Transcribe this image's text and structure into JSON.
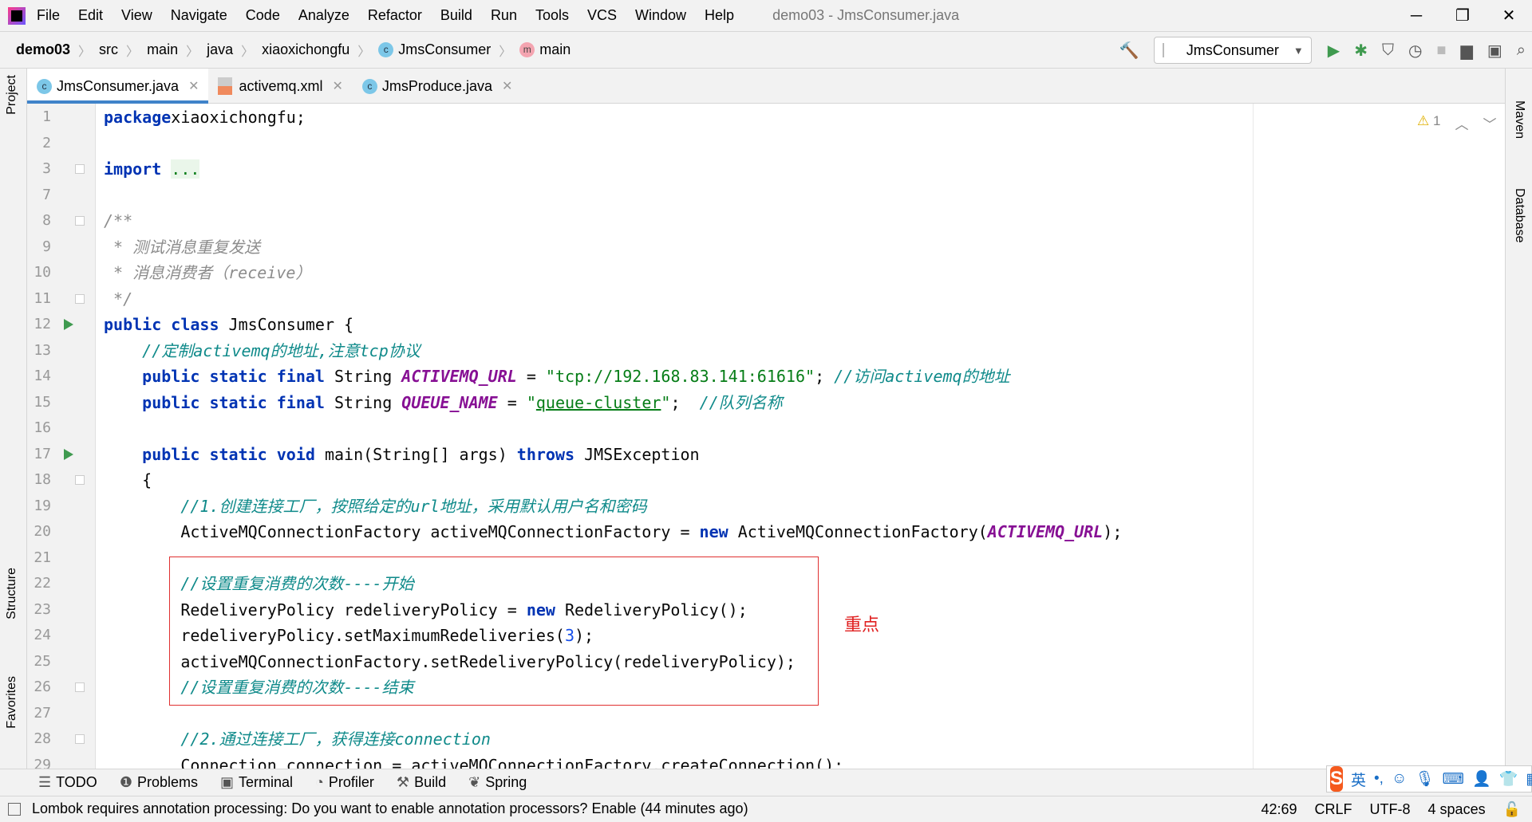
{
  "window": {
    "title": "demo03 - JmsConsumer.java"
  },
  "menu": [
    "File",
    "Edit",
    "View",
    "Navigate",
    "Code",
    "Analyze",
    "Refactor",
    "Build",
    "Run",
    "Tools",
    "VCS",
    "Window",
    "Help"
  ],
  "breadcrumb": [
    "demo03",
    "src",
    "main",
    "java",
    "xiaoxichongfu",
    "JmsConsumer",
    "main"
  ],
  "run_config": "JmsConsumer",
  "tabs": [
    {
      "label": "JmsConsumer.java",
      "active": true
    },
    {
      "label": "activemq.xml"
    },
    {
      "label": "JmsProduce.java"
    }
  ],
  "left_tools": {
    "project": "Project",
    "structure": "Structure",
    "favorites": "Favorites"
  },
  "right_tools": {
    "maven": "Maven",
    "database": "Database"
  },
  "inspections": {
    "warnings": "1"
  },
  "annotation": {
    "label": "重点",
    "color": "#e03030"
  },
  "code": {
    "line_numbers": [
      1,
      2,
      3,
      7,
      8,
      9,
      10,
      11,
      12,
      13,
      14,
      15,
      16,
      17,
      18,
      19,
      20,
      21,
      22,
      23,
      24,
      25,
      26,
      27,
      28,
      29
    ],
    "lines": [
      [
        [
          "kw",
          "package"
        ],
        [
          "",
          "xiaoxichongfu;"
        ]
      ],
      [],
      [
        [
          "kw",
          "import"
        ],
        [
          "",
          " "
        ],
        [
          "fold",
          "..."
        ]
      ],
      [],
      [
        [
          "doc",
          "/**"
        ]
      ],
      [
        [
          "doc",
          " * 测试消息重复发送"
        ]
      ],
      [
        [
          "doc",
          " * 消息消费者（receive）"
        ]
      ],
      [
        [
          "doc",
          " */"
        ]
      ],
      [
        [
          "kw",
          "public class"
        ],
        [
          "",
          " JmsConsumer {"
        ]
      ],
      [
        [
          "",
          "    "
        ],
        [
          "cm",
          "//定制activemq的地址,注意tcp协议"
        ]
      ],
      [
        [
          "",
          "    "
        ],
        [
          "kw",
          "public static final"
        ],
        [
          "",
          " String "
        ],
        [
          "fld",
          "ACTIVEMQ_URL"
        ],
        [
          "",
          " = "
        ],
        [
          "str",
          "\"tcp://192.168.83.141:61616\""
        ],
        [
          "",
          "; "
        ],
        [
          "cm",
          "//访问activemq的地址"
        ]
      ],
      [
        [
          "",
          "    "
        ],
        [
          "kw",
          "public static final"
        ],
        [
          "",
          " String "
        ],
        [
          "fld",
          "QUEUE_NAME"
        ],
        [
          "",
          " = "
        ],
        [
          "str",
          "\""
        ],
        [
          "str und",
          "queue-cluster"
        ],
        [
          "str",
          "\""
        ],
        [
          "",
          ";  "
        ],
        [
          "cm",
          "//队列名称"
        ]
      ],
      [],
      [
        [
          "",
          "    "
        ],
        [
          "kw",
          "public static void"
        ],
        [
          "",
          " main(String[] args) "
        ],
        [
          "kw",
          "throws"
        ],
        [
          "",
          " JMSException"
        ]
      ],
      [
        [
          "",
          "    {"
        ]
      ],
      [
        [
          "",
          "        "
        ],
        [
          "cm",
          "//1.创建连接工厂，按照给定的url地址，采用默认用户名和密码"
        ]
      ],
      [
        [
          "",
          "        ActiveMQConnectionFactory activeMQConnectionFactory = "
        ],
        [
          "kw",
          "new"
        ],
        [
          "",
          " ActiveMQConnectionFactory("
        ],
        [
          "fld",
          "ACTIVEMQ_URL"
        ],
        [
          "",
          ");"
        ]
      ],
      [],
      [
        [
          "",
          "        "
        ],
        [
          "cm",
          "//设置重复消费的次数----开始"
        ]
      ],
      [
        [
          "",
          "        RedeliveryPolicy redeliveryPolicy = "
        ],
        [
          "kw",
          "new"
        ],
        [
          "",
          " RedeliveryPolicy();"
        ]
      ],
      [
        [
          "",
          "        redeliveryPolicy.setMaximumRedeliveries("
        ],
        [
          "num",
          "3"
        ],
        [
          "",
          ");"
        ]
      ],
      [
        [
          "",
          "        activeMQConnectionFactory.setRedeliveryPolicy(redeliveryPolicy);"
        ]
      ],
      [
        [
          "",
          "        "
        ],
        [
          "cm",
          "//设置重复消费的次数----结束"
        ]
      ],
      [],
      [
        [
          "",
          "        "
        ],
        [
          "cm",
          "//2.通过连接工厂，获得连接connection"
        ]
      ],
      [
        [
          "",
          "        Connection connection = activeMQConnectionFactory.createConnection();"
        ]
      ]
    ],
    "run_gutter_lines": [
      12,
      17
    ],
    "fold_lines": [
      3,
      8,
      11,
      18,
      26,
      28
    ]
  },
  "tool_windows": [
    "TODO",
    "Problems",
    "Terminal",
    "Profiler",
    "Build",
    "Spring"
  ],
  "status": {
    "message": "Lombok requires annotation processing: Do you want to enable annotation processors? Enable (44 minutes ago)",
    "position": "42:69",
    "line_sep": "CRLF",
    "encoding": "UTF-8",
    "indent": "4 spaces"
  },
  "ime": {
    "logo": "S",
    "lang": "英"
  }
}
